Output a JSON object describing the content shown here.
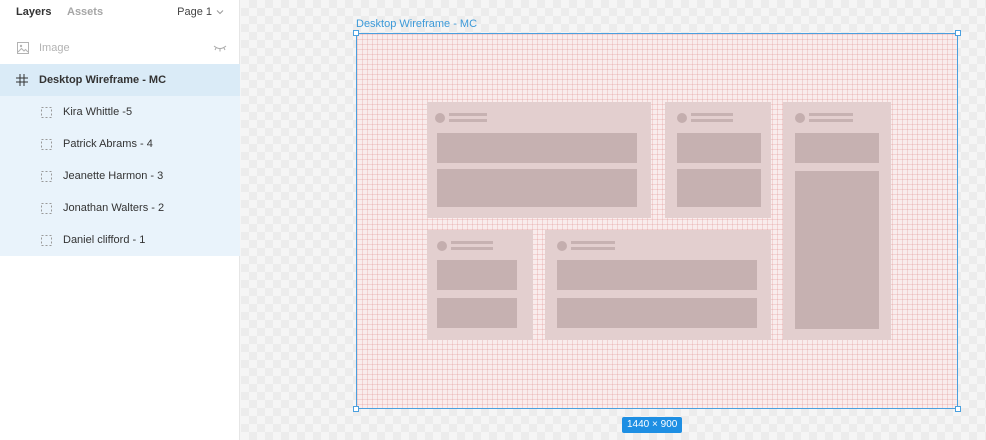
{
  "panel": {
    "tabs": {
      "layers": "Layers",
      "assets": "Assets"
    },
    "page_selector": "Page 1",
    "layers": {
      "image": "Image",
      "frame": "Desktop Wireframe - MC",
      "children": [
        "Kira Whittle -5",
        "Patrick Abrams - 4",
        "Jeanette Harmon - 3",
        "Jonathan Walters - 2",
        "Daniel clifford - 1"
      ]
    }
  },
  "canvas": {
    "frame_label": "Desktop Wireframe - MC",
    "frame_size": "1440 × 900"
  },
  "colors": {
    "selection_blue": "#4aa0df",
    "size_badge_bg": "#1e8fe3",
    "selected_layer_bg": "#daebf7",
    "grid_line": "#dc7878"
  },
  "icons": {
    "image_layer": "image-icon",
    "frame_layer": "hash-frame-icon",
    "child_layer": "dashed-square-icon",
    "hidden": "eye-closed-icon",
    "page_dropdown": "chevron-down-icon"
  }
}
